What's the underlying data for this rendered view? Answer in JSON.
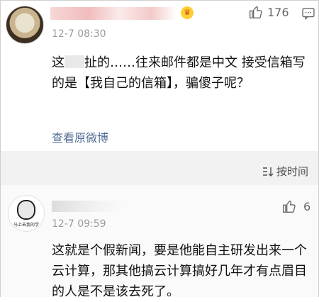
{
  "comment1": {
    "time": "12-7 08:30",
    "like_count": "176",
    "text_before_mask": "这",
    "text_after_mask": "扯的……往来邮件都是中文 接受信箱写的是【我自己的信箱】，骗傻子呢？",
    "view_original": "查看原微博",
    "badge_icon": "crown-icon"
  },
  "sort": {
    "label": "按时间",
    "icon": "sort-icon"
  },
  "comment2": {
    "avatar_caption": "马上去我的学",
    "time": "12-7 09:59",
    "like_count": "6",
    "text": "这就是个假新闻，要是他能自主研发出来一个云计算，那其他搞云计算搞好几年才有点眉目的人是不是该去死了。"
  },
  "colors": {
    "link": "#516d93",
    "meta": "#9b9b9b",
    "sortbar_bg": "#f2f2f2"
  }
}
